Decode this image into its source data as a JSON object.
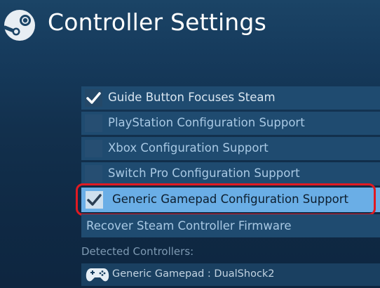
{
  "header": {
    "title": "Controller Settings",
    "logo_icon": "steam-logo-icon"
  },
  "options": [
    {
      "label": "Guide Button Focuses Steam",
      "checked": true
    },
    {
      "label": "PlayStation Configuration Support",
      "checked": false
    },
    {
      "label": "Xbox Configuration Support",
      "checked": false
    },
    {
      "label": "Switch Pro Configuration Support",
      "checked": false
    },
    {
      "label": "Generic Gamepad Configuration Support",
      "checked": true
    }
  ],
  "recover": {
    "label": "Recover Steam Controller Firmware"
  },
  "detected": {
    "heading": "Detected Controllers:",
    "devices": [
      {
        "name": "Generic Gamepad : DualShock2",
        "icon": "gamepad-icon"
      }
    ]
  },
  "colors": {
    "highlight": "#6aaee6",
    "annotation": "#e01a22",
    "row": "#1f4b70"
  }
}
